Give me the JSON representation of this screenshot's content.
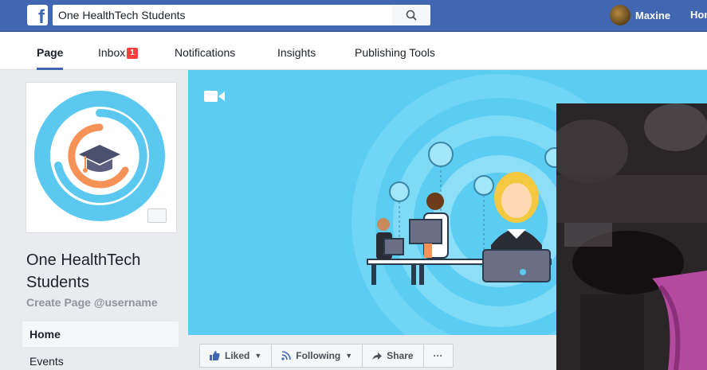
{
  "topbar": {
    "logo": "f",
    "search_value": "One HealthTech Students",
    "user_name": "Maxine",
    "home_label": "Home"
  },
  "tabs": [
    {
      "label": "Page",
      "active": true
    },
    {
      "label": "Inbox",
      "badge": "1"
    },
    {
      "label": "Notifications"
    },
    {
      "label": "Insights"
    },
    {
      "label": "Publishing Tools"
    }
  ],
  "profile": {
    "name": "One HealthTech Students",
    "username_link": "Create Page @username"
  },
  "sidebar": {
    "items": [
      {
        "label": "Home",
        "active": true
      },
      {
        "label": "Events"
      }
    ]
  },
  "actions": {
    "liked": "Liked",
    "following": "Following",
    "share": "Share",
    "more": "···"
  },
  "colors": {
    "brand": "#4267b2",
    "cover_bg": "#5bcdf2",
    "logo_blue": "#5bc8ef",
    "logo_orange": "#f79256",
    "badge": "#fa3e3e"
  },
  "icons": [
    "facebook-logo-icon",
    "search-icon",
    "video-camera-icon",
    "camera-icon",
    "thumbs-up-icon",
    "rss-icon",
    "share-arrow-icon",
    "graduation-cap-icon"
  ]
}
